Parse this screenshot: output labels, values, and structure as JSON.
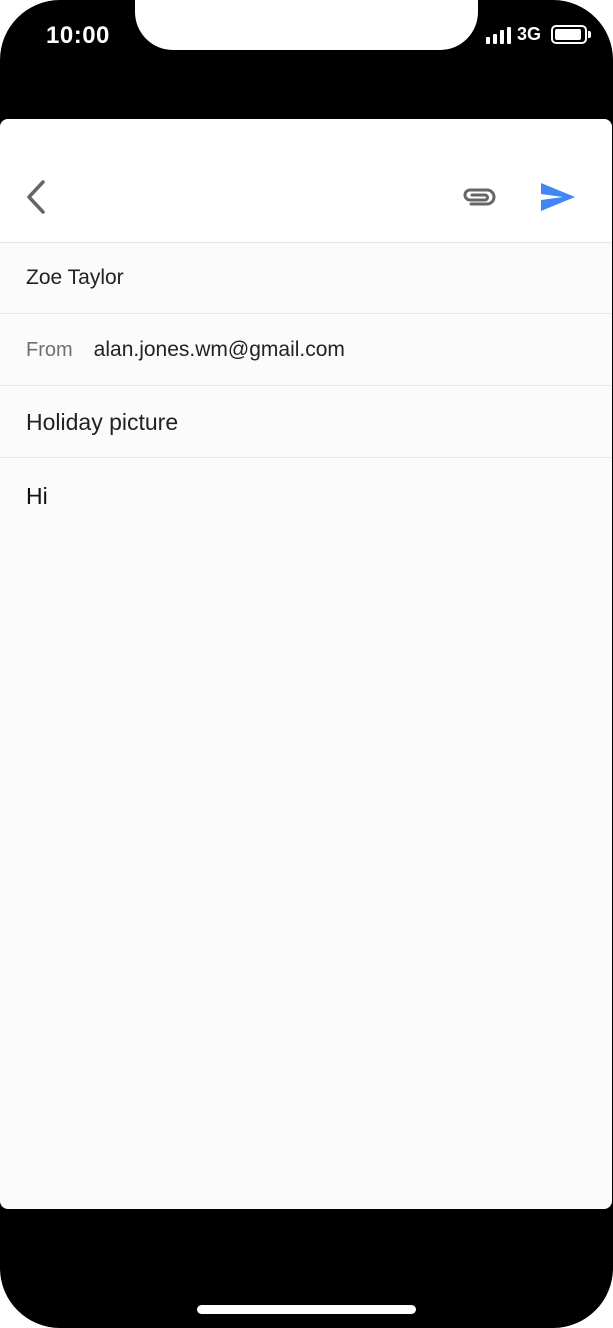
{
  "status_bar": {
    "time": "10:00",
    "network": "3G"
  },
  "toolbar": {
    "back_icon": "chevron-left-icon",
    "attach_icon": "paperclip-icon",
    "send_icon": "send-icon",
    "accent_color": "#4285f4",
    "icon_color": "#666666"
  },
  "compose": {
    "to": "Zoe Taylor",
    "from_label": "From",
    "from_value": "alan.jones.wm@gmail.com",
    "subject": "Holiday picture",
    "body": "Hi"
  }
}
